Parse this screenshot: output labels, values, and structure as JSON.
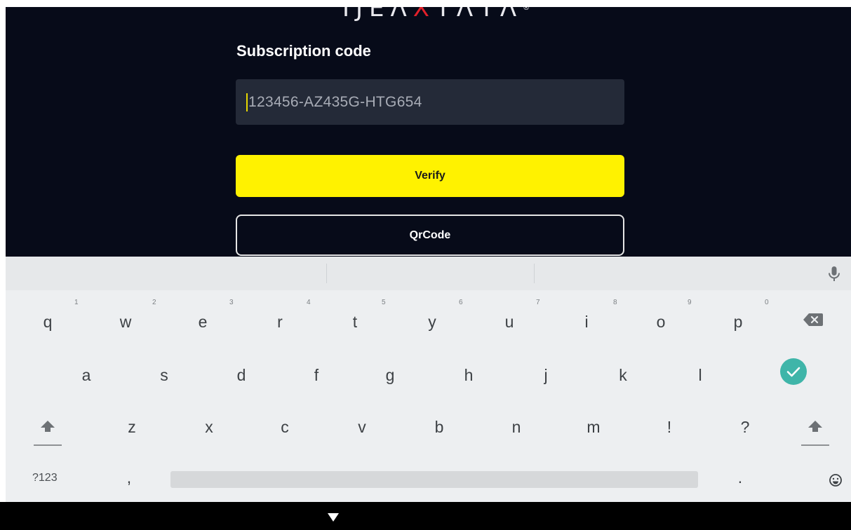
{
  "app": {
    "logo_left": "ΙJEΛ",
    "logo_mark": "X",
    "logo_right": "ΤΛΤΛ",
    "logo_reg": "®",
    "field_label": "Subscription code",
    "input_value": "123456-AZ435G-HTG654",
    "verify_label": "Verify",
    "qrcode_label": "QrCode",
    "accent_color": "#fff200",
    "background_color": "#070b19"
  },
  "keyboard": {
    "row1": [
      {
        "key": "q",
        "hint": "1"
      },
      {
        "key": "w",
        "hint": "2"
      },
      {
        "key": "e",
        "hint": "3"
      },
      {
        "key": "r",
        "hint": "4"
      },
      {
        "key": "t",
        "hint": "5"
      },
      {
        "key": "y",
        "hint": "6"
      },
      {
        "key": "u",
        "hint": "7"
      },
      {
        "key": "i",
        "hint": "8"
      },
      {
        "key": "o",
        "hint": "9"
      },
      {
        "key": "p",
        "hint": "0"
      }
    ],
    "row2": [
      "a",
      "s",
      "d",
      "f",
      "g",
      "h",
      "j",
      "k",
      "l"
    ],
    "row3": [
      "z",
      "x",
      "c",
      "v",
      "b",
      "n",
      "m",
      "!",
      "?"
    ],
    "symbols_label": "?123",
    "comma": ",",
    "period": ".",
    "icons": [
      "mic-icon",
      "backspace-icon",
      "enter-check-icon",
      "shift-icon",
      "emoji-icon"
    ],
    "enter_color": "#3fb5a9"
  },
  "navbar": {
    "icons": [
      "nav-down-icon"
    ]
  }
}
